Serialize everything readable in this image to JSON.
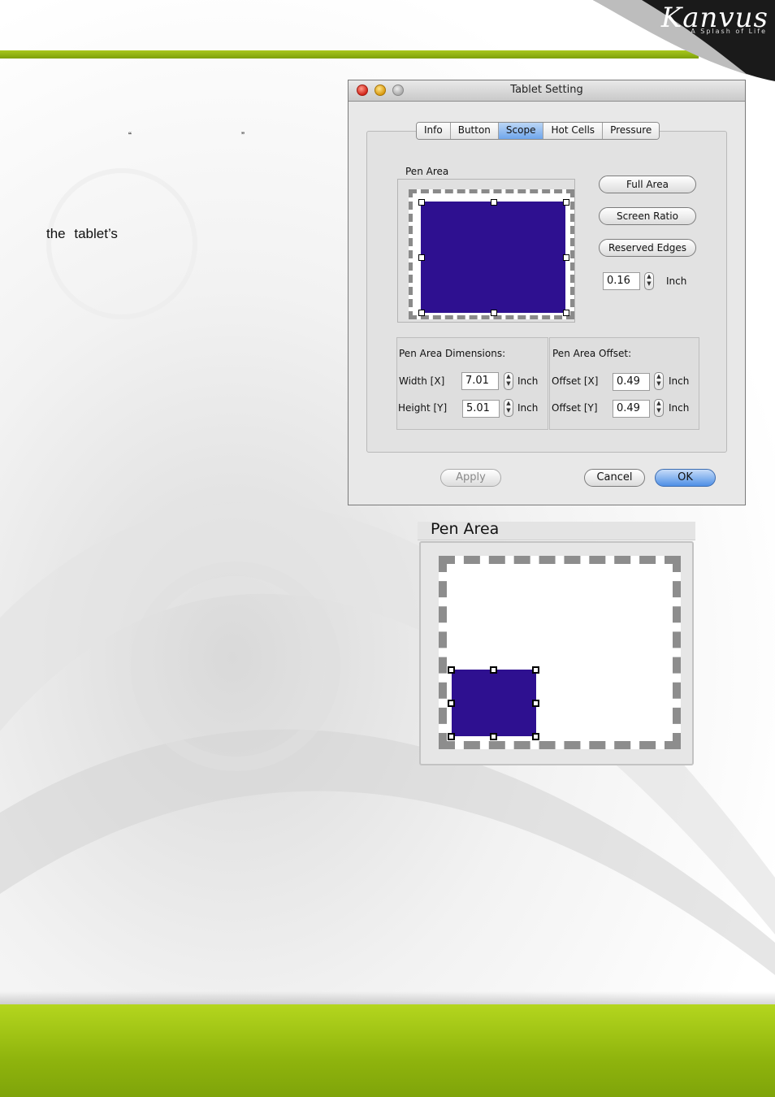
{
  "brand": {
    "name": "Kanvus",
    "tagline": "A Splash of Life",
    "accent_green": "#8fb40d"
  },
  "page_text": {
    "quote_open": "“",
    "quote_close": "”",
    "fragment": "the tablet’s"
  },
  "dialog": {
    "title": "Tablet Setting",
    "tabs": [
      "Info",
      "Button",
      "Scope",
      "Hot Cells",
      "Pressure"
    ],
    "active_tab": "Scope",
    "pen_area_label": "Pen Area",
    "buttons": {
      "full_area": "Full Area",
      "screen_ratio": "Screen Ratio",
      "reserved_edges": "Reserved Edges"
    },
    "reserved_value": "0.16",
    "reserved_unit": "Inch",
    "dimensions": {
      "title": "Pen Area Dimensions:",
      "width_label": "Width  [X]",
      "width_value": "7.01",
      "height_label": "Height [Y]",
      "height_value": "5.01",
      "unit": "Inch"
    },
    "offset": {
      "title": "Pen Area Offset:",
      "x_label": "Offset [X]",
      "x_value": "0.49",
      "y_label": "Offset [Y]",
      "y_value": "0.49",
      "unit": "Inch"
    },
    "footer": {
      "apply": "Apply",
      "cancel": "Cancel",
      "ok": "OK"
    },
    "pen_color": "#2e1090"
  },
  "zoom_view": {
    "title": "Pen Area"
  }
}
